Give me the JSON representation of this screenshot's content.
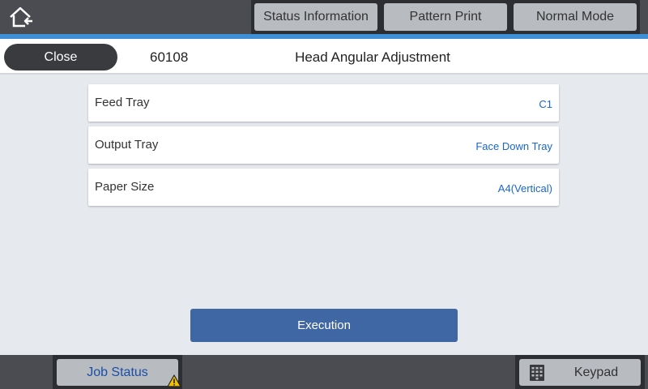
{
  "topbar": {
    "home_icon": "home-icon",
    "tabs": [
      "Status Information",
      "Pattern Print",
      "Normal Mode"
    ]
  },
  "titlebar": {
    "close_label": "Close",
    "code": "60108",
    "title": "Head Angular Adjustment"
  },
  "settings": [
    {
      "label": "Feed Tray",
      "value": "C1"
    },
    {
      "label": "Output Tray",
      "value": "Face Down Tray"
    },
    {
      "label": "Paper Size",
      "value": "A4(Vertical)"
    }
  ],
  "execution_label": "Execution",
  "bottombar": {
    "job_status_label": "Job Status",
    "warning_icon": "warning-icon",
    "keypad_label": "Keypad",
    "keypad_icon": "keypad-icon"
  },
  "colors": {
    "accent": "#3f8fd6",
    "execution_button": "#3f67a3",
    "value_text": "#1a66cc"
  }
}
